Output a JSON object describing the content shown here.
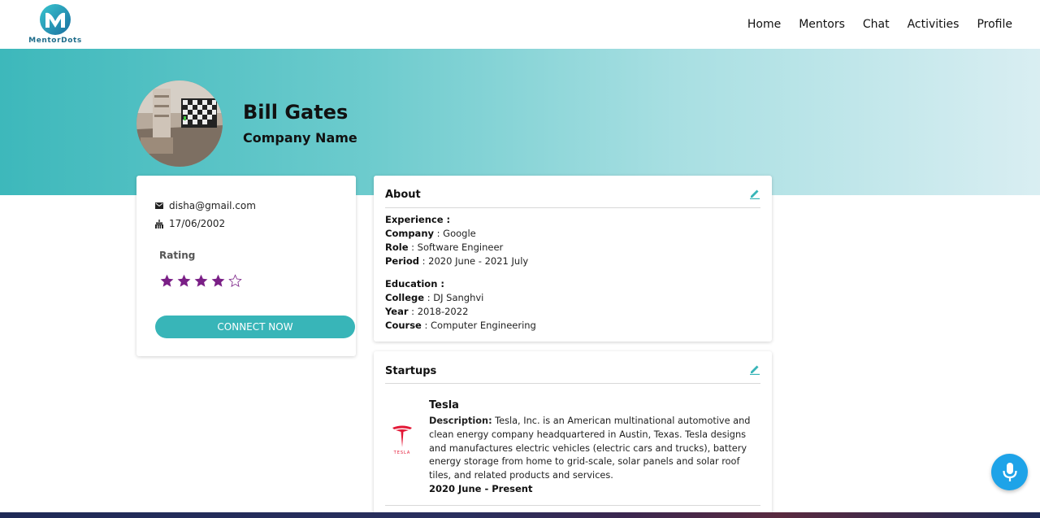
{
  "brand": {
    "name": "MentorDots"
  },
  "nav": {
    "items": [
      {
        "label": "Home"
      },
      {
        "label": "Mentors"
      },
      {
        "label": "Chat"
      },
      {
        "label": "Activities"
      },
      {
        "label": "Profile"
      }
    ]
  },
  "profile": {
    "name": "Bill Gates",
    "company": "Company Name",
    "email": "disha@gmail.com",
    "dob": "17/06/2002",
    "rating_label": "Rating",
    "rating": 4,
    "rating_max": 5,
    "connect_label": "CONNECT NOW"
  },
  "about": {
    "title": "About",
    "experience_heading": "Experience :",
    "company_label": "Company",
    "company_value": " : Google",
    "role_label": "Role",
    "role_value": " : Software Engineer",
    "period_label": "Period",
    "period_value": " : 2020 June - 2021 July",
    "education_heading": "Education :",
    "college_label": "College",
    "college_value": " : DJ Sanghvi",
    "year_label": "Year",
    "year_value": " : 2018-2022",
    "course_label": "Course",
    "course_value": " : Computer Engineering"
  },
  "startups": {
    "title": "Startups",
    "items": [
      {
        "name": "Tesla",
        "desc_label": "Description:",
        "desc_text": " Tesla, Inc. is an American multinational automotive and clean energy company headquartered in Austin, Texas. Tesla designs and manufactures electric vehicles (electric cars and trucks), battery energy storage from home to grid-scale, solar panels and solar roof tiles, and related products and services.",
        "period": "2020 June - Present",
        "logo_text": "TESLA"
      }
    ]
  },
  "colors": {
    "accent": "#38b5b8",
    "star": "#7a1f86",
    "mic": "#1ea3e8",
    "tesla_red": "#e31937"
  },
  "icons": {
    "email": "email-icon",
    "cake": "birthday-cake-icon",
    "edit": "pencil-icon",
    "mic": "microphone-icon"
  }
}
